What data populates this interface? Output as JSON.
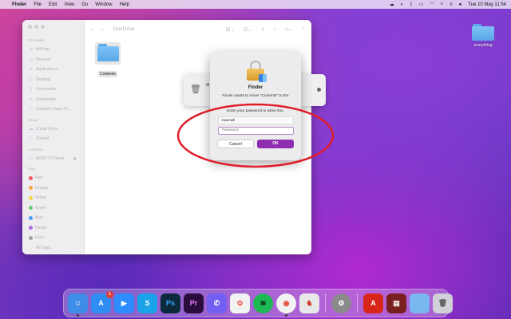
{
  "menubar": {
    "items": [
      "Finder",
      "File",
      "Edit",
      "View",
      "Go",
      "Window",
      "Help"
    ],
    "clock": "Tue 10 May  11:54"
  },
  "desktop": {
    "folder_label": "everything"
  },
  "finder": {
    "title": "OneDrive",
    "sidebar": {
      "favourites_heading": "Favourites",
      "favourites": [
        "AirDrop",
        "Recents",
        "Applications",
        "Desktop",
        "Documents",
        "Downloads",
        "Creative Cloud Fil..."
      ],
      "icloud_heading": "iCloud",
      "icloud": [
        "iCloud Drive",
        "Shared"
      ],
      "locations_heading": "Locations",
      "locations": [
        "NOW TV Player"
      ],
      "tags_heading": "Tags",
      "tags": [
        {
          "label": "Red",
          "color": "#f05a5a"
        },
        {
          "label": "Orange",
          "color": "#f5a443"
        },
        {
          "label": "Yellow",
          "color": "#f3d34a"
        },
        {
          "label": "Green",
          "color": "#5fcf6b"
        },
        {
          "label": "Blue",
          "color": "#4a9ff5"
        },
        {
          "label": "Purple",
          "color": "#b06fe0"
        },
        {
          "label": "Grey",
          "color": "#a0a0a0"
        },
        {
          "label": "All Tags...",
          "color": ""
        }
      ]
    },
    "items": [
      {
        "label": "Contents"
      }
    ]
  },
  "move_window": {
    "label": "M"
  },
  "auth_dialog": {
    "title": "Finder",
    "message": "Finder wants to move \"Contents\" to the",
    "prompt": "Enter your password to allow this.",
    "username": "Hannah",
    "password_placeholder": "Password",
    "cancel_label": "Cancel",
    "ok_label": "OK"
  },
  "dock": {
    "apps": [
      {
        "name": "finder",
        "glyph": "☺",
        "color": "#3c8ce8",
        "badge": ""
      },
      {
        "name": "app-store",
        "glyph": "A",
        "color": "#2f8cf0",
        "badge": "1"
      },
      {
        "name": "zoom",
        "glyph": "▶",
        "color": "#2d8cff",
        "badge": ""
      },
      {
        "name": "skype",
        "glyph": "S",
        "color": "#1aa3e8",
        "badge": ""
      },
      {
        "name": "photoshop",
        "glyph": "Ps",
        "color": "#0d2a3d",
        "badge": ""
      },
      {
        "name": "premiere",
        "glyph": "Pr",
        "color": "#2a0d3d",
        "badge": ""
      },
      {
        "name": "viber",
        "glyph": "✆",
        "color": "#7360f2",
        "badge": ""
      },
      {
        "name": "photos",
        "glyph": "✿",
        "color": "#f2f2f2",
        "badge": ""
      },
      {
        "name": "spotify",
        "glyph": "≋",
        "color": "#1db954",
        "badge": ""
      },
      {
        "name": "chrome",
        "glyph": "◉",
        "color": "#f2f2f2",
        "badge": ""
      },
      {
        "name": "app-horse",
        "glyph": "♞",
        "color": "#e8e8e8",
        "badge": ""
      },
      {
        "name": "system-preferences",
        "glyph": "⚙",
        "color": "#8a8a8a",
        "badge": ""
      },
      {
        "name": "acrobat",
        "glyph": "A",
        "color": "#d8261b",
        "badge": ""
      },
      {
        "name": "archive",
        "glyph": "▤",
        "color": "#7a1f1f",
        "badge": ""
      },
      {
        "name": "downloads-folder",
        "glyph": "",
        "color": "#78b8ef",
        "badge": ""
      },
      {
        "name": "trash",
        "glyph": "🗑",
        "color": "#d0d0d8",
        "badge": ""
      }
    ]
  }
}
